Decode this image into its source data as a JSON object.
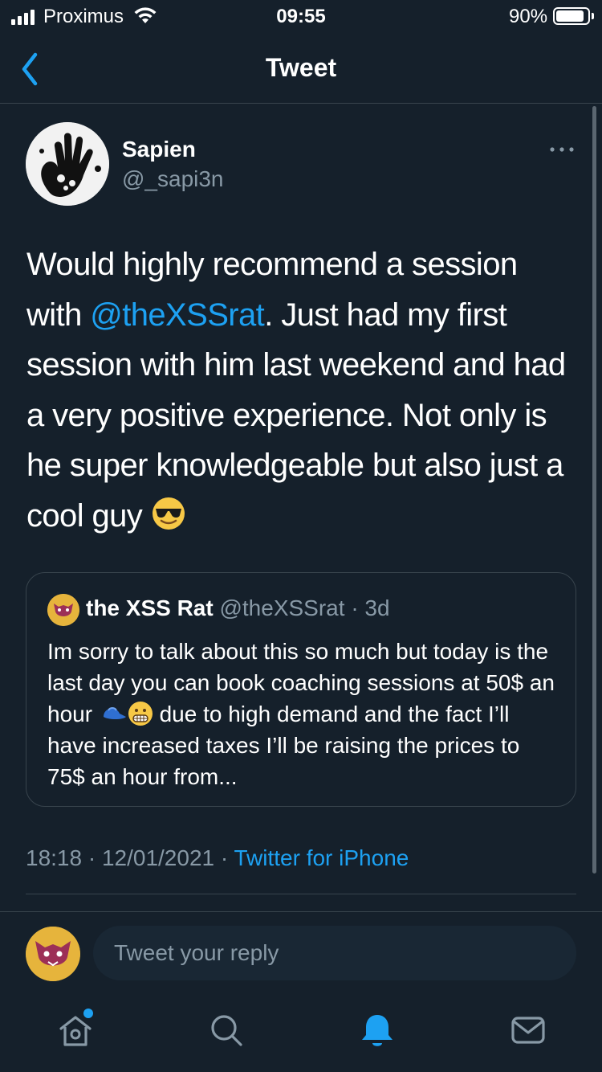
{
  "status_bar": {
    "carrier": "Proximus",
    "time": "09:55",
    "battery_percent": "90%",
    "battery_level": 0.9
  },
  "header": {
    "title": "Tweet"
  },
  "tweet": {
    "author_name": "Sapien",
    "author_handle": "@_sapi3n",
    "text_before": "Would highly recommend a session with ",
    "mention": "@theXSSrat",
    "text_after": ". Just had my first session with him last weekend and had a very positive experience. Not only is he super knowledgeable but also just a cool guy ",
    "emoji": "smiling-face-with-sunglasses",
    "timestamp": "18:18 · 12/01/2021 · ",
    "client": "Twitter for iPhone"
  },
  "quoted_tweet": {
    "author_name": "the XSS Rat",
    "meta": " @theXSSrat · 3d",
    "text_part1": "Im sorry to talk about this so much but today is the last day you can book coaching sessions at 50$ an hour ",
    "emojis": [
      "blue-cap",
      "grimacing-face"
    ],
    "text_part2": " due to high demand and the fact I’ll have increased taxes I’ll be raising the prices to 75$ an hour from..."
  },
  "reply": {
    "placeholder": "Tweet your reply"
  },
  "tab_bar": {
    "icons": [
      "home-icon",
      "search-icon",
      "notifications-icon",
      "messages-icon"
    ],
    "active": "notifications",
    "home_has_notification_dot": true
  },
  "colors": {
    "background": "#15202b",
    "accent": "#1da1f2",
    "secondary_text": "#8899a6",
    "border": "#38444d"
  }
}
